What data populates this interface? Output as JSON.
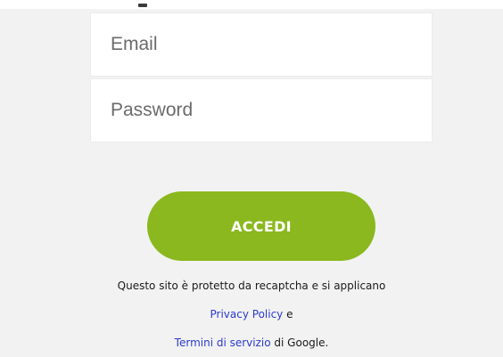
{
  "form": {
    "email_placeholder": "Email",
    "password_placeholder": "Password",
    "login_label": "ACCEDI"
  },
  "recaptcha": {
    "intro": "Questo sito è protetto da recaptcha e si applicano",
    "privacy_link": "Privacy Policy",
    "conjunction": " e",
    "terms_link": "Termini di servizio",
    "suffix": " di Google."
  },
  "colors": {
    "accent": "#8ab81e",
    "link": "#2a3bd0",
    "background": "#f2f2f2"
  }
}
